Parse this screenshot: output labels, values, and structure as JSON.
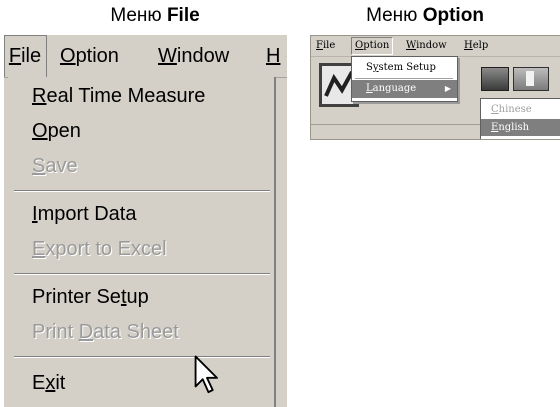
{
  "captions": {
    "left": {
      "prefix": "Меню ",
      "bold": "File"
    },
    "right": {
      "prefix": "Меню ",
      "bold": "Option"
    }
  },
  "left_panel": {
    "menubar": {
      "file": {
        "mnemonic": "F",
        "rest": "ile"
      },
      "option": {
        "mnemonic": "O",
        "rest": "ption"
      },
      "window": {
        "mnemonic": "W",
        "rest": "indow"
      },
      "help": {
        "mnemonic": "H",
        "rest": ""
      }
    },
    "file_menu": {
      "real_time": {
        "before": "",
        "mnemonic": "R",
        "after": "eal Time Measure",
        "enabled": true
      },
      "open": {
        "before": "",
        "mnemonic": "O",
        "after": "pen",
        "enabled": true
      },
      "save": {
        "before": "",
        "mnemonic": "S",
        "after": "ave",
        "enabled": false
      },
      "import": {
        "before": "",
        "mnemonic": "I",
        "after": "mport Data",
        "enabled": true
      },
      "export": {
        "before": "",
        "mnemonic": "E",
        "after": "xport to Excel",
        "enabled": false
      },
      "printer_setup": {
        "before": "Printer Se",
        "mnemonic": "t",
        "after": "up",
        "enabled": true
      },
      "print_sheet": {
        "before": "Print ",
        "mnemonic": "D",
        "after": "ata Sheet",
        "enabled": false
      },
      "exit": {
        "before": "E",
        "mnemonic": "x",
        "after": "it",
        "enabled": true
      }
    }
  },
  "right_panel": {
    "menubar": {
      "file": {
        "mnemonic": "F",
        "rest": "ile"
      },
      "option": {
        "mnemonic": "O",
        "rest": "ption"
      },
      "window": {
        "mnemonic": "W",
        "rest": "indow"
      },
      "help": {
        "mnemonic": "H",
        "rest": "elp"
      }
    },
    "option_menu": {
      "system_setup": {
        "before": "S",
        "mnemonic": "y",
        "after": "stem Setup"
      },
      "language": {
        "before": "",
        "mnemonic": "L",
        "after": "anguage"
      }
    },
    "language_menu": {
      "chinese": {
        "mnemonic": "C",
        "rest": "hinese",
        "enabled": false
      },
      "english": {
        "mnemonic": "E",
        "rest": "nglish",
        "enabled": true,
        "highlighted": true
      }
    }
  },
  "colors": {
    "menu_bg": "#d4d0c8",
    "highlight": "#7f7f7f",
    "disabled_text": "#9a9a9a"
  },
  "icons": [
    "mouse-pointer-icon",
    "submenu-arrow-icon",
    "toolbar-chart-icon"
  ]
}
